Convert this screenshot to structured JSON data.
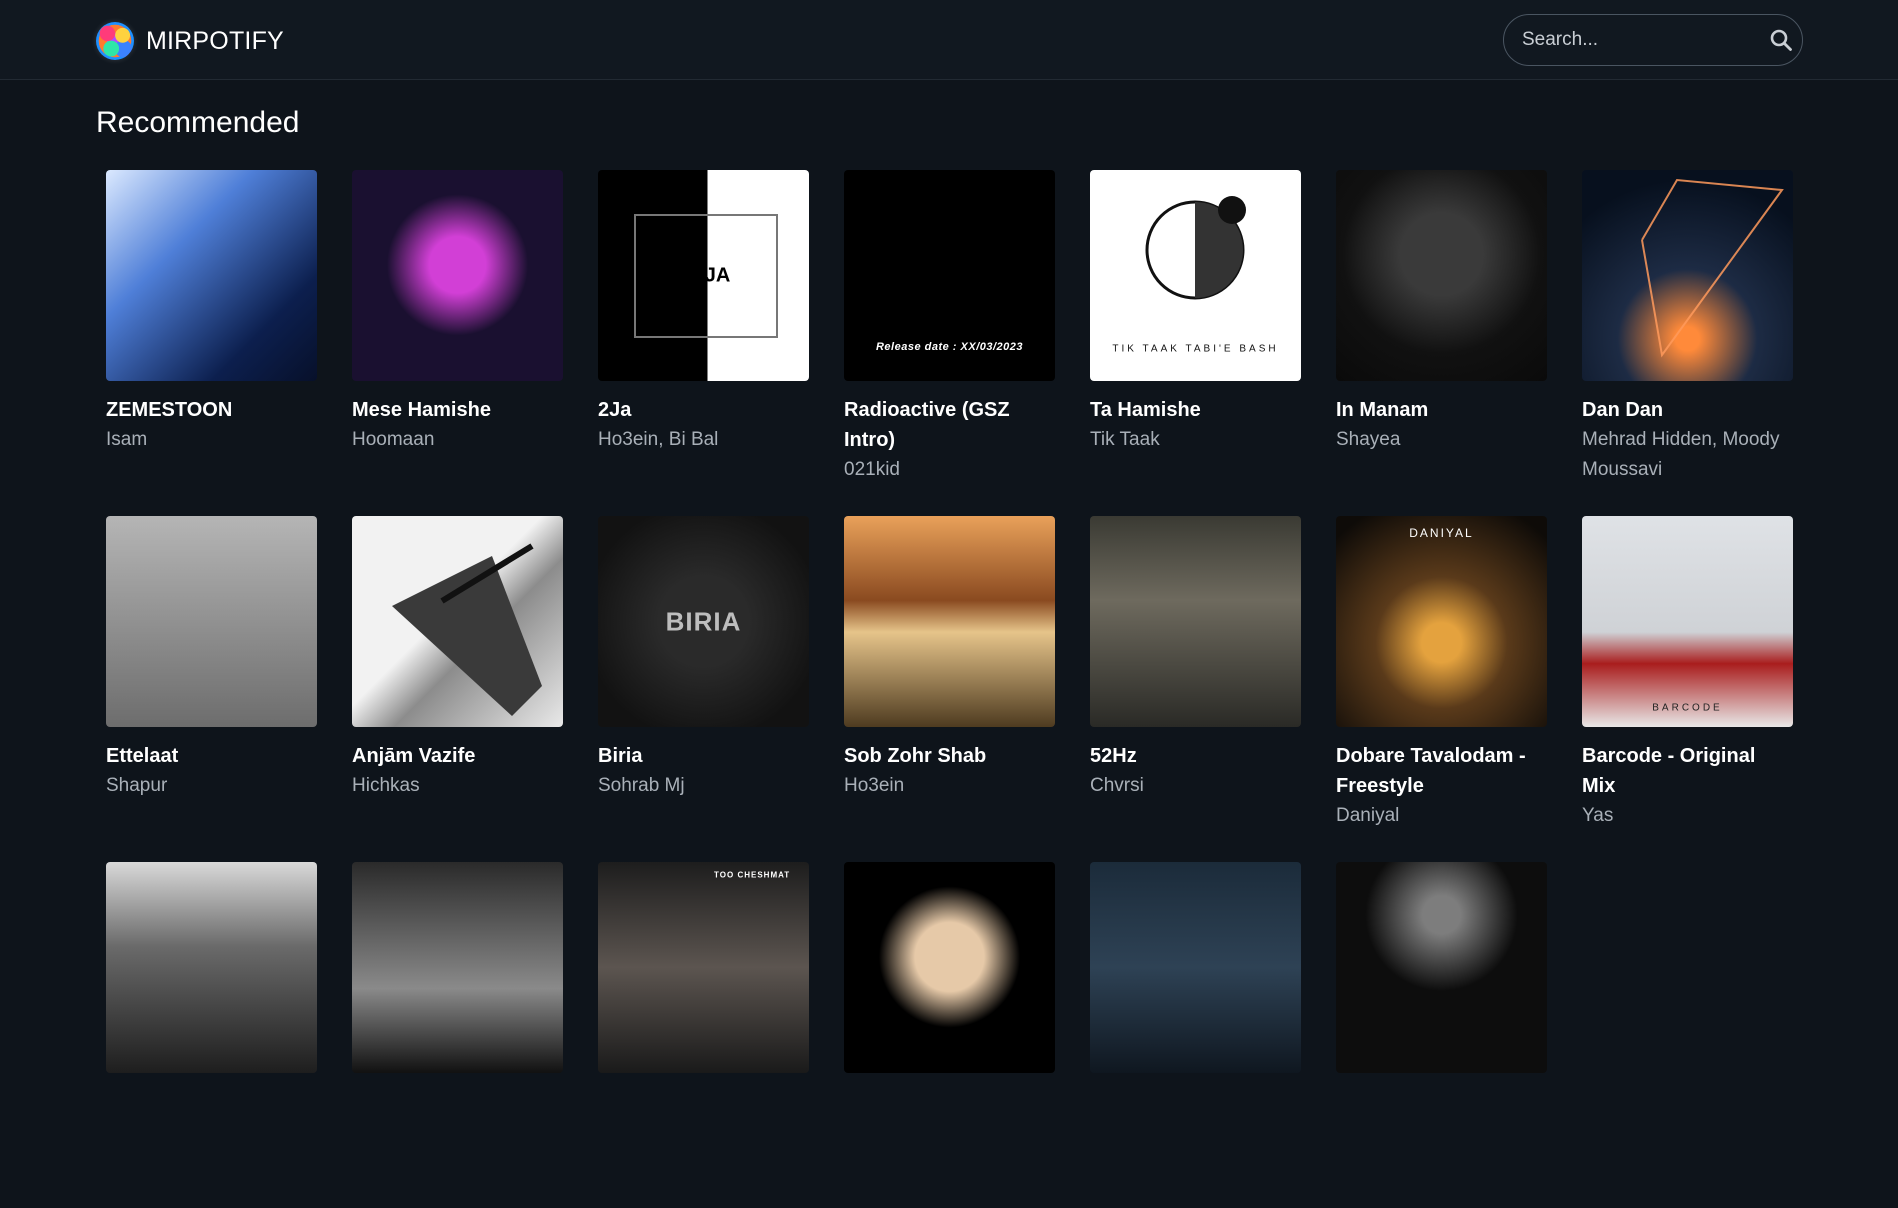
{
  "app": {
    "brand_name": "MIRPOTIFY",
    "logo_icon": "colorful-splash-logo-icon"
  },
  "search": {
    "placeholder": "Search...",
    "value": "",
    "icon": "search-icon"
  },
  "section": {
    "title": "Recommended"
  },
  "tracks": [
    {
      "title": "ZEMESTOON",
      "artist": "Isam",
      "cover_text": ""
    },
    {
      "title": "Mese Hamishe",
      "artist": "Hoomaan",
      "cover_text": ""
    },
    {
      "title": "2Ja",
      "artist": "Ho3ein, Bi Bal",
      "cover_text": "2JA"
    },
    {
      "title": "Radioactive (GSZ Intro)",
      "artist": "021kid",
      "cover_text": "Release date : XX/03/2023"
    },
    {
      "title": "Ta Hamishe",
      "artist": "Tik Taak",
      "cover_text": "TIK TAAK TABI'E BASH"
    },
    {
      "title": "In Manam",
      "artist": "Shayea",
      "cover_text": ""
    },
    {
      "title": "Dan Dan",
      "artist": "Mehrad Hidden, Moody Moussavi",
      "cover_text": ""
    },
    {
      "title": "Ettelaat",
      "artist": "Shapur",
      "cover_text": ""
    },
    {
      "title": "Anjām Vazife",
      "artist": "Hichkas",
      "cover_text": ""
    },
    {
      "title": "Biria",
      "artist": "Sohrab Mj",
      "cover_text": "BIRIA"
    },
    {
      "title": "Sob Zohr Shab",
      "artist": "Ho3ein",
      "cover_text": ""
    },
    {
      "title": "52Hz",
      "artist": "Chvrsi",
      "cover_text": ""
    },
    {
      "title": "Dobare Tavalodam - Freestyle",
      "artist": "Daniyal",
      "cover_text": "DANIYAL"
    },
    {
      "title": "Barcode - Original Mix",
      "artist": "Yas",
      "cover_text": "BARCODE"
    },
    {
      "title": "",
      "artist": "",
      "cover_text": ""
    },
    {
      "title": "",
      "artist": "",
      "cover_text": ""
    },
    {
      "title": "",
      "artist": "",
      "cover_text": "TOO CHESHMAT"
    },
    {
      "title": "",
      "artist": "",
      "cover_text": ""
    },
    {
      "title": "",
      "artist": "",
      "cover_text": ""
    },
    {
      "title": "",
      "artist": "",
      "cover_text": ""
    }
  ]
}
